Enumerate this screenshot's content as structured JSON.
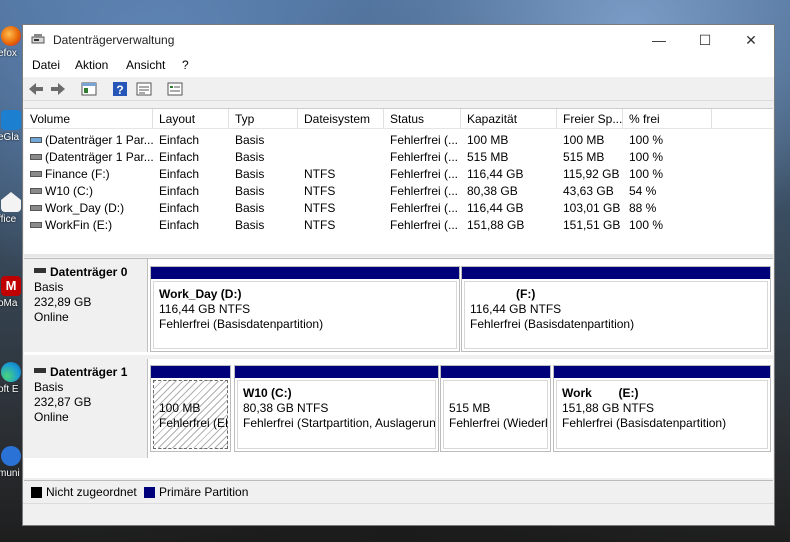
{
  "window": {
    "title": "Datenträgerverwaltung",
    "minimize_glyph": "—",
    "maximize_glyph": "☐",
    "close_glyph": "✕"
  },
  "desktop_icons": [
    {
      "label": "efox",
      "icon": "firefox-icon",
      "color": "#e66000"
    },
    {
      "label": "eGla",
      "icon": "app-icon",
      "color": "#1d7fd0"
    },
    {
      "label": "ffice",
      "icon": "office-icon",
      "color": "#ffffff"
    },
    {
      "label": "oMa",
      "icon": "mail-icon",
      "color": "#c00000"
    },
    {
      "label": "oft E",
      "icon": "edge-icon",
      "color": "#1a9bd6"
    },
    {
      "label": "muni",
      "icon": "app-icon",
      "color": "#2b72d6"
    }
  ],
  "menu": [
    "Datei",
    "Aktion",
    "Ansicht",
    "?"
  ],
  "toolbar": {
    "buttons": [
      "back-arrow-icon",
      "forward-arrow-icon",
      "properties-icon",
      "help-icon",
      "details-icon",
      "console-icon"
    ]
  },
  "volume_list": {
    "headers": [
      "Volume",
      "Layout",
      "Typ",
      "Dateisystem",
      "Status",
      "Kapazität",
      "Freier Sp...",
      "% frei"
    ],
    "rows": [
      {
        "volume": "(Datenträger 1 Par...",
        "layout": "Einfach",
        "typ": "Basis",
        "fs": "",
        "status": "Fehlerfrei (...",
        "kap": "100 MB",
        "frei": "100 MB",
        "pct": "100 %"
      },
      {
        "volume": "(Datenträger 1 Par...",
        "layout": "Einfach",
        "typ": "Basis",
        "fs": "",
        "status": "Fehlerfrei (...",
        "kap": "515 MB",
        "frei": "515 MB",
        "pct": "100 %"
      },
      {
        "volume": "Finance (F:)",
        "layout": "Einfach",
        "typ": "Basis",
        "fs": "NTFS",
        "status": "Fehlerfrei (...",
        "kap": "116,44 GB",
        "frei": "115,92 GB",
        "pct": "100 %"
      },
      {
        "volume": "W10 (C:)",
        "layout": "Einfach",
        "typ": "Basis",
        "fs": "NTFS",
        "status": "Fehlerfrei (...",
        "kap": "80,38 GB",
        "frei": "43,63 GB",
        "pct": "54 %"
      },
      {
        "volume": "Work_Day (D:)",
        "layout": "Einfach",
        "typ": "Basis",
        "fs": "NTFS",
        "status": "Fehlerfrei (...",
        "kap": "116,44 GB",
        "frei": "103,01 GB",
        "pct": "88 %"
      },
      {
        "volume": "WorkFin (E:)",
        "layout": "Einfach",
        "typ": "Basis",
        "fs": "NTFS",
        "status": "Fehlerfrei (...",
        "kap": "151,88 GB",
        "frei": "151,51 GB",
        "pct": "100 %"
      }
    ]
  },
  "disks": [
    {
      "name": "Datenträger 0",
      "type": "Basis",
      "size": "232,89 GB",
      "state": "Online",
      "partitions": [
        {
          "name": "Work_Day  (D:)",
          "size": "116,44 GB NTFS",
          "status": "Fehlerfrei (Basisdatenpartition)"
        },
        {
          "name": "(F:)",
          "size": "116,44 GB NTFS",
          "status": "Fehlerfrei (Basisdatenpartition)"
        }
      ]
    },
    {
      "name": "Datenträger 1",
      "type": "Basis",
      "size": "232,87 GB",
      "state": "Online",
      "partitions": [
        {
          "name": "",
          "size": "100 MB",
          "status": "Fehlerfrei (EF"
        },
        {
          "name": "W10  (C:)",
          "size": "80,38 GB NTFS",
          "status": "Fehlerfrei (Startpartition, Auslagerun"
        },
        {
          "name": "",
          "size": "515 MB",
          "status": "Fehlerfrei (Wiederh"
        },
        {
          "name": "Work        (E:)",
          "size": "151,88 GB NTFS",
          "status": "Fehlerfrei (Basisdatenpartition)"
        }
      ]
    }
  ],
  "legend": {
    "unallocated": "Nicht zugeordnet",
    "primary": "Primäre Partition",
    "unallocated_color": "#000000",
    "primary_color": "#00007b"
  }
}
